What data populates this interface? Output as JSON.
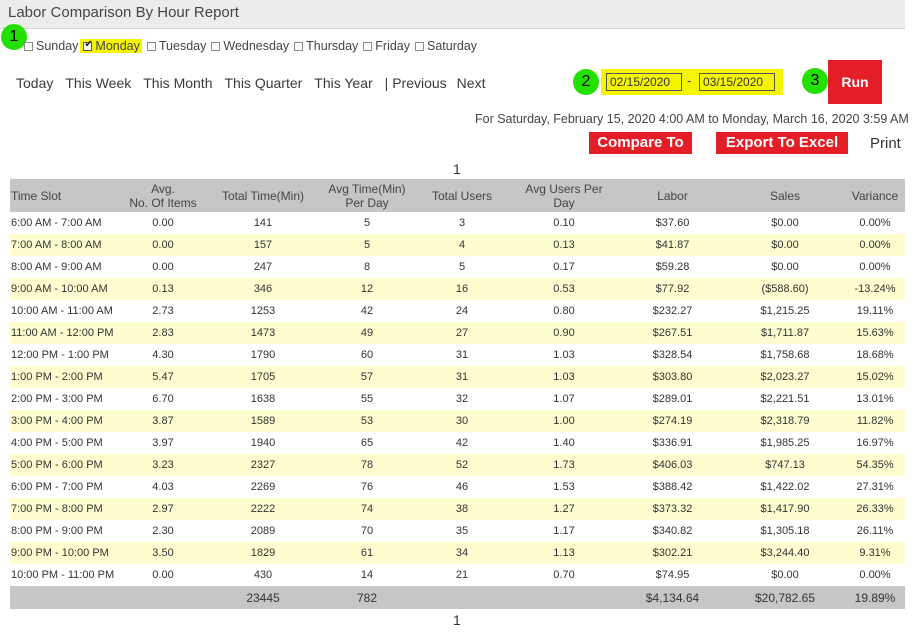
{
  "window": {
    "title": "Labor Comparison By Hour Report"
  },
  "callouts": [
    "1",
    "2",
    "3"
  ],
  "days": [
    {
      "label": "Sunday",
      "checked": false
    },
    {
      "label": "Monday",
      "checked": true
    },
    {
      "label": "Tuesday",
      "checked": false
    },
    {
      "label": "Wednesday",
      "checked": false
    },
    {
      "label": "Thursday",
      "checked": false
    },
    {
      "label": "Friday",
      "checked": false
    },
    {
      "label": "Saturday",
      "checked": false
    }
  ],
  "ranges": [
    "Today",
    "This Week",
    "This Month",
    "This Quarter",
    "This Year",
    "| Previous",
    "Next"
  ],
  "dates": {
    "from": "02/15/2020",
    "sep": "-",
    "to": "03/15/2020"
  },
  "actions": {
    "run": "Run",
    "compare": "Compare To",
    "export": "Export To Excel",
    "print": "Print"
  },
  "period": "For Saturday, February 15, 2020 4:00 AM to Monday, March 16, 2020 3:59 AM",
  "page": "1",
  "table": {
    "headers": [
      "Time Slot",
      "Avg.\nNo. Of Items",
      "Total Time(Min)",
      "Avg Time(Min)\nPer Day",
      "Total Users",
      "Avg Users Per\nDay",
      "Labor",
      "Sales",
      "Variance"
    ],
    "rows": [
      [
        "6:00 AM - 7:00 AM",
        "0.00",
        "141",
        "5",
        "3",
        "0.10",
        "$37.60",
        "$0.00",
        "0.00%"
      ],
      [
        "7:00 AM - 8:00 AM",
        "0.00",
        "157",
        "5",
        "4",
        "0.13",
        "$41.87",
        "$0.00",
        "0.00%"
      ],
      [
        "8:00 AM - 9:00 AM",
        "0.00",
        "247",
        "8",
        "5",
        "0.17",
        "$59.28",
        "$0.00",
        "0.00%"
      ],
      [
        "9:00 AM - 10:00 AM",
        "0.13",
        "346",
        "12",
        "16",
        "0.53",
        "$77.92",
        "($588.60)",
        "-13.24%"
      ],
      [
        "10:00 AM - 11:00 AM",
        "2.73",
        "1253",
        "42",
        "24",
        "0.80",
        "$232.27",
        "$1,215.25",
        "19.11%"
      ],
      [
        "11:00 AM - 12:00 PM",
        "2.83",
        "1473",
        "49",
        "27",
        "0.90",
        "$267.51",
        "$1,711.87",
        "15.63%"
      ],
      [
        "12:00 PM - 1:00 PM",
        "4.30",
        "1790",
        "60",
        "31",
        "1.03",
        "$328.54",
        "$1,758.68",
        "18.68%"
      ],
      [
        "1:00 PM - 2:00 PM",
        "5.47",
        "1705",
        "57",
        "31",
        "1.03",
        "$303.80",
        "$2,023.27",
        "15.02%"
      ],
      [
        "2:00 PM - 3:00 PM",
        "6.70",
        "1638",
        "55",
        "32",
        "1.07",
        "$289.01",
        "$2,221.51",
        "13.01%"
      ],
      [
        "3:00 PM - 4:00 PM",
        "3.87",
        "1589",
        "53",
        "30",
        "1.00",
        "$274.19",
        "$2,318.79",
        "11.82%"
      ],
      [
        "4:00 PM - 5:00 PM",
        "3.97",
        "1940",
        "65",
        "42",
        "1.40",
        "$336.91",
        "$1,985.25",
        "16.97%"
      ],
      [
        "5:00 PM - 6:00 PM",
        "3.23",
        "2327",
        "78",
        "52",
        "1.73",
        "$406.03",
        "$747.13",
        "54.35%"
      ],
      [
        "6:00 PM - 7:00 PM",
        "4.03",
        "2269",
        "76",
        "46",
        "1.53",
        "$388.42",
        "$1,422.02",
        "27.31%"
      ],
      [
        "7:00 PM - 8:00 PM",
        "2.97",
        "2222",
        "74",
        "38",
        "1.27",
        "$373.32",
        "$1,417.90",
        "26.33%"
      ],
      [
        "8:00 PM - 9:00 PM",
        "2.30",
        "2089",
        "70",
        "35",
        "1.17",
        "$340.82",
        "$1,305.18",
        "26.11%"
      ],
      [
        "9:00 PM - 10:00 PM",
        "3.50",
        "1829",
        "61",
        "34",
        "1.13",
        "$302.21",
        "$3,244.40",
        "9.31%"
      ],
      [
        "10:00 PM - 11:00 PM",
        "0.00",
        "430",
        "14",
        "21",
        "0.70",
        "$74.95",
        "$0.00",
        "0.00%"
      ]
    ],
    "totals": [
      "",
      "",
      "23445",
      "782",
      "",
      "",
      "$4,134.64",
      "$20,782.65",
      "19.89%"
    ]
  }
}
